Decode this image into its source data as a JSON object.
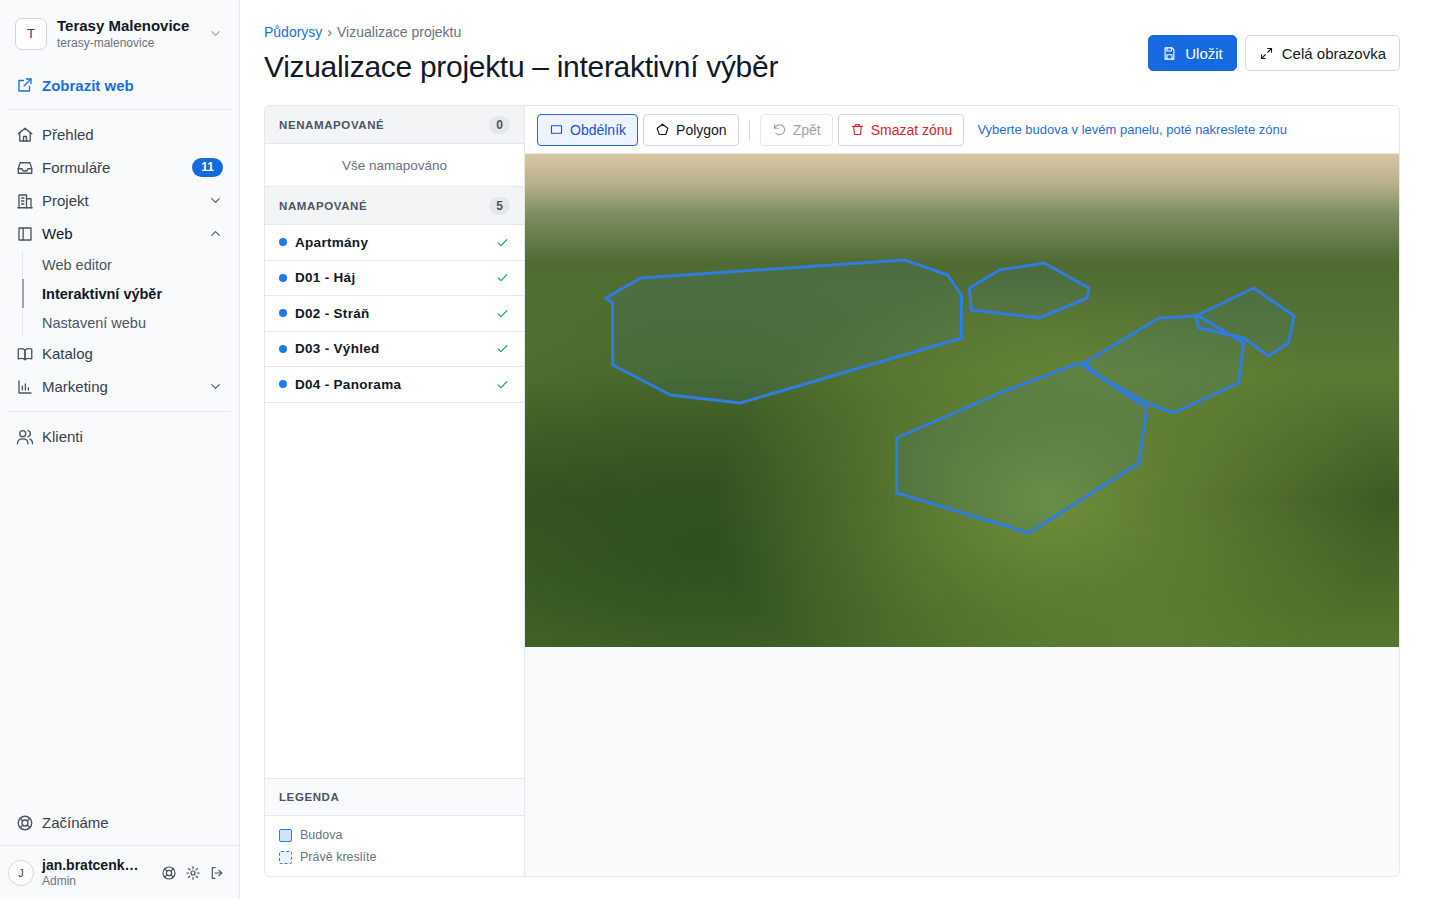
{
  "sidebar": {
    "workspace": {
      "avatar": "T",
      "name": "Terasy Malenovice",
      "slug": "terasy-malenovice"
    },
    "view_site": "Zobrazit web",
    "nav": [
      {
        "label": "Přehled",
        "kind": "link",
        "selected": false
      },
      {
        "label": "Formuláře",
        "kind": "link",
        "selected": false,
        "badge": "11"
      },
      {
        "label": "Projekt",
        "kind": "group",
        "expanded": false,
        "selected": false
      },
      {
        "label": "Web",
        "kind": "group",
        "expanded": true,
        "selected": false,
        "children": [
          {
            "label": "Web editor",
            "selected": false
          },
          {
            "label": "Interaktivní výběr",
            "selected": true
          },
          {
            "label": "Nastavení webu",
            "selected": false
          }
        ]
      },
      {
        "label": "Katalog",
        "kind": "link",
        "selected": false
      },
      {
        "label": "Marketing",
        "kind": "group",
        "expanded": false,
        "selected": false
      }
    ],
    "nav_secondary": [
      {
        "label": "Klienti",
        "kind": "link",
        "selected": false
      }
    ],
    "help": "Začínáme",
    "user": {
      "avatar": "J",
      "name": "jan.bratcenk…",
      "role": "Admin"
    }
  },
  "header": {
    "breadcrumb": [
      {
        "label": "Půdorysy",
        "link": true
      },
      {
        "label": "Vizualizace projektu",
        "link": false
      }
    ],
    "separator": "›",
    "title": "Vizualizace projektu – interaktivní výběr",
    "actions": [
      {
        "label": "Uložit",
        "kind": "primary"
      },
      {
        "label": "Celá obrazovka",
        "kind": "secondary"
      }
    ]
  },
  "unmapped": {
    "title": "NENAMAPOVANÉ",
    "count": "0",
    "empty": "Vše namapováno"
  },
  "mapped": {
    "title": "NAMAPOVANÉ",
    "count": "5",
    "items": [
      {
        "name": "Apartmány",
        "mapped": true
      },
      {
        "name": "D01 - Háj",
        "mapped": true
      },
      {
        "name": "D02 - Stráň",
        "mapped": true
      },
      {
        "name": "D03 - Výhled",
        "mapped": true
      },
      {
        "name": "D04 - Panorama",
        "mapped": true
      }
    ]
  },
  "legend": {
    "title": "LEGENDA",
    "items": [
      {
        "label": "Budova",
        "kind": "solid"
      },
      {
        "label": "Právě kreslíte",
        "kind": "dashed"
      }
    ]
  },
  "toolbar": {
    "tools": [
      {
        "label": "Obdélník",
        "selected": true
      },
      {
        "label": "Polygon",
        "selected": false
      }
    ],
    "undo": {
      "label": "Zpět",
      "disabled": true
    },
    "delete": "Smazat zónu",
    "hint": "Vyberte budova v levém panelu, poté nakreslete zónu"
  }
}
